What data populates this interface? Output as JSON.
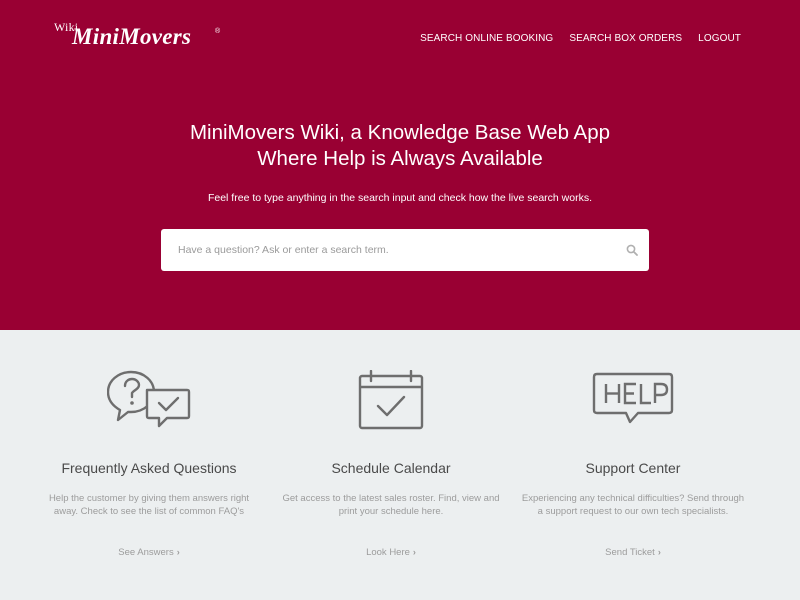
{
  "brand": {
    "wiki": "Wiki",
    "name": "MiniMovers",
    "reg": "®"
  },
  "nav": {
    "items": [
      {
        "label": "SEARCH ONLINE BOOKING"
      },
      {
        "label": "SEARCH BOX ORDERS"
      },
      {
        "label": "LOGOUT"
      }
    ]
  },
  "hero": {
    "title_line1": "MiniMovers Wiki, a Knowledge Base Web App",
    "title_line2": "Where Help is Always Available",
    "subtitle": "Feel free to type anything in the search input and check how the live search works."
  },
  "search": {
    "placeholder": "Have a question? Ask or enter a search term.",
    "value": "",
    "icon": "search-icon"
  },
  "features": [
    {
      "icon": "faq-speech-bubbles-icon",
      "title": "Frequently Asked Questions",
      "description": "Help the customer by giving them answers right away. Check to see the list of common FAQ's",
      "link": "See Answers"
    },
    {
      "icon": "calendar-check-icon",
      "title": "Schedule Calendar",
      "description": "Get access to the latest sales roster. Find, view and print your schedule here.",
      "link": "Look Here"
    },
    {
      "icon": "help-speech-bubble-icon",
      "title": "Support Center",
      "description": "Experiencing any technical difficulties? Send through a support request to our own tech specialists.",
      "link": "Send Ticket"
    }
  ],
  "colors": {
    "brand": "#990033",
    "section_bg": "#eceff0",
    "icon_stroke": "#6e6e6e",
    "muted_text": "#9c9c9c"
  }
}
